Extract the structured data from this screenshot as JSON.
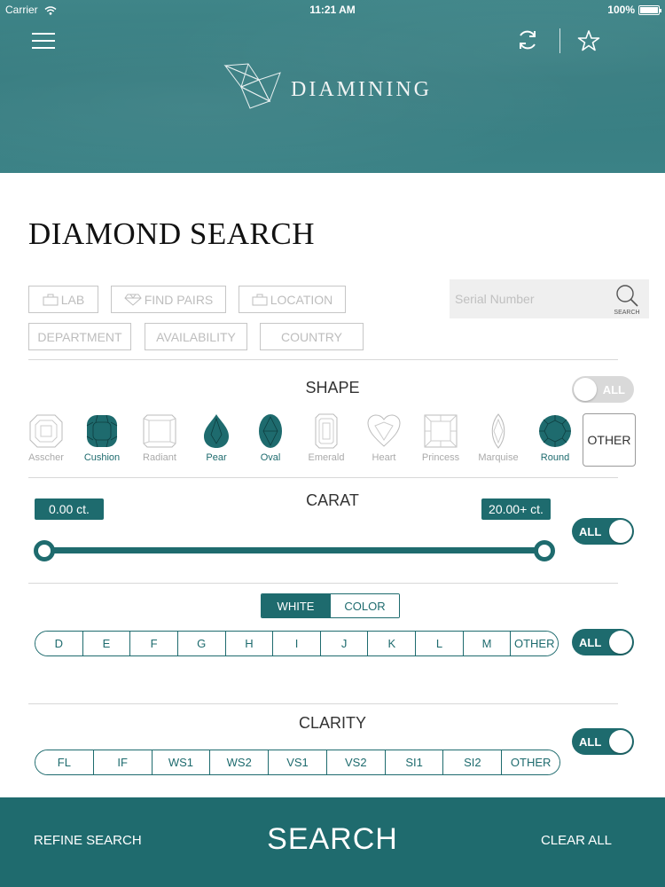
{
  "status_bar": {
    "carrier": "Carrier",
    "time": "11:21 AM",
    "battery": "100%"
  },
  "header": {
    "brand": "DIAMINING"
  },
  "page_title": "DIAMOND SEARCH",
  "filters": {
    "row1": [
      {
        "label": "LAB",
        "icon": "bag-icon"
      },
      {
        "label": "FIND PAIRS",
        "icon": "diamond-icon"
      },
      {
        "label": "LOCATION",
        "icon": "bag-icon"
      }
    ],
    "row2": [
      {
        "label": "DEPARTMENT"
      },
      {
        "label": "AVAILABILITY"
      },
      {
        "label": "COUNTRY"
      }
    ],
    "serial_placeholder": "Serial Number",
    "search_label": "SEARCH"
  },
  "shape": {
    "title": "SHAPE",
    "all_label": "ALL",
    "items": [
      {
        "name": "Asscher",
        "selected": false
      },
      {
        "name": "Cushion",
        "selected": true
      },
      {
        "name": "Radiant",
        "selected": false
      },
      {
        "name": "Pear",
        "selected": true
      },
      {
        "name": "Oval",
        "selected": true
      },
      {
        "name": "Emerald",
        "selected": false
      },
      {
        "name": "Heart",
        "selected": false
      },
      {
        "name": "Princess",
        "selected": false
      },
      {
        "name": "Marquise",
        "selected": false
      },
      {
        "name": "Round",
        "selected": true
      }
    ],
    "other_label": "OTHER"
  },
  "carat": {
    "title": "CARAT",
    "min_label": "0.00 ct.",
    "max_label": "20.00+ ct.",
    "all_label": "ALL"
  },
  "color": {
    "tabs": [
      {
        "label": "WHITE",
        "active": true
      },
      {
        "label": "COLOR",
        "active": false
      }
    ],
    "grades": [
      "D",
      "E",
      "F",
      "G",
      "H",
      "I",
      "J",
      "K",
      "L",
      "M",
      "OTHER"
    ],
    "all_label": "ALL"
  },
  "clarity": {
    "title": "CLARITY",
    "grades": [
      "FL",
      "IF",
      "WS1",
      "WS2",
      "VS1",
      "VS2",
      "SI1",
      "SI2",
      "OTHER"
    ],
    "all_label": "ALL"
  },
  "footer": {
    "refine": "REFINE SEARCH",
    "search": "SEARCH",
    "clear": "CLEAR ALL"
  },
  "colors": {
    "teal": "#1e6b6e",
    "header_teal": "#3b8286"
  }
}
